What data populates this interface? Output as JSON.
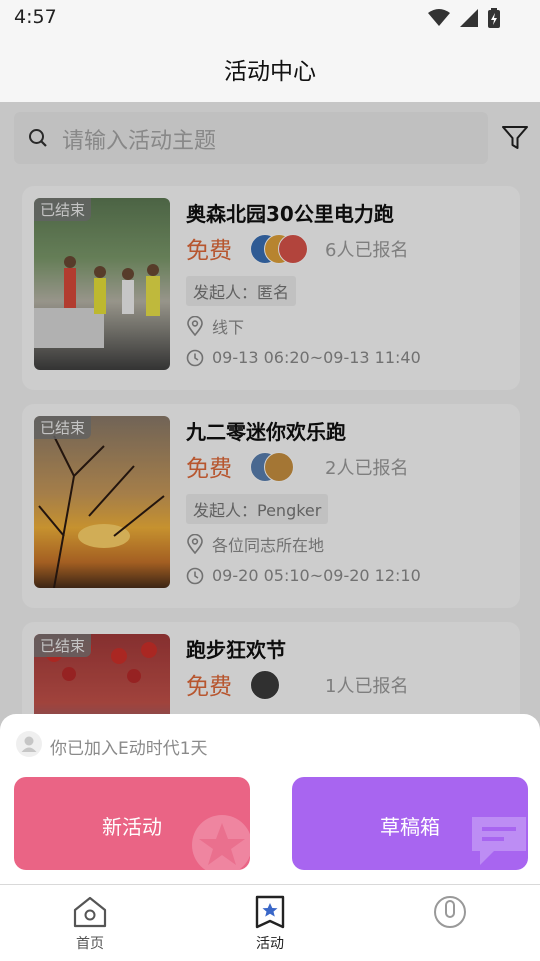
{
  "status_bar": {
    "time": "4:57"
  },
  "header": {
    "title": "活动中心"
  },
  "search": {
    "placeholder": "请输入活动主题"
  },
  "activities": [
    {
      "badge": "已结束",
      "title": "奥森北园30公里电力跑",
      "price": "免费",
      "signup": "6人已报名",
      "organizer": "发起人：匿名",
      "location": "线下",
      "time": "09-13 06:20~09-13 11:40"
    },
    {
      "badge": "已结束",
      "title": "九二零迷你欢乐跑",
      "price": "免费",
      "signup": "2人已报名",
      "organizer": "发起人：Pengker",
      "location": "各位同志所在地",
      "time": "09-20 05:10~09-20 12:10"
    },
    {
      "badge": "已结束",
      "title": "跑步狂欢节",
      "price": "免费",
      "signup": "1人已报名"
    }
  ],
  "sheet": {
    "join_text": "你已加入E动时代1天",
    "new_button": "新活动",
    "draft_button": "草稿箱"
  },
  "nav": {
    "home": "首页",
    "activity": "活动"
  },
  "colors": {
    "accent_price": "#e06a3a",
    "new_button": "#ea6485",
    "draft_button": "#a865f0"
  }
}
